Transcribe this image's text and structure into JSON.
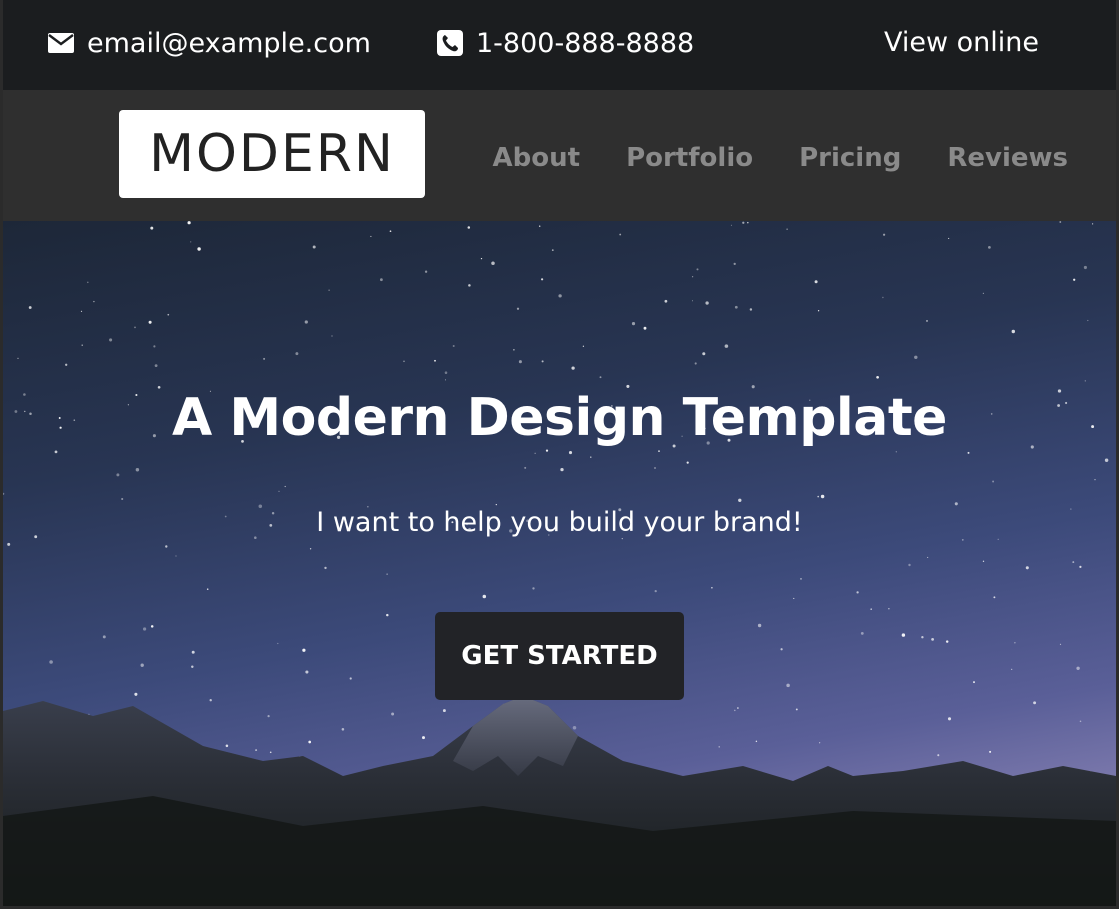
{
  "topbar": {
    "email": "email@example.com",
    "phone": "1-800-888-8888",
    "view_online": "View online",
    "email_icon": "envelope-icon",
    "phone_icon": "phone-icon"
  },
  "navbar": {
    "logo": "MODERN",
    "links": [
      "About",
      "Portfolio",
      "Pricing",
      "Reviews"
    ]
  },
  "hero": {
    "title": "A Modern Design Template",
    "subtitle": "I want to help you build your brand!",
    "cta": "GET STARTED"
  },
  "colors": {
    "topbar_bg": "#1b1d1f",
    "navbar_bg": "#2f2f2f",
    "nav_link": "#8a8a8a",
    "cta_bg": "#222327"
  }
}
